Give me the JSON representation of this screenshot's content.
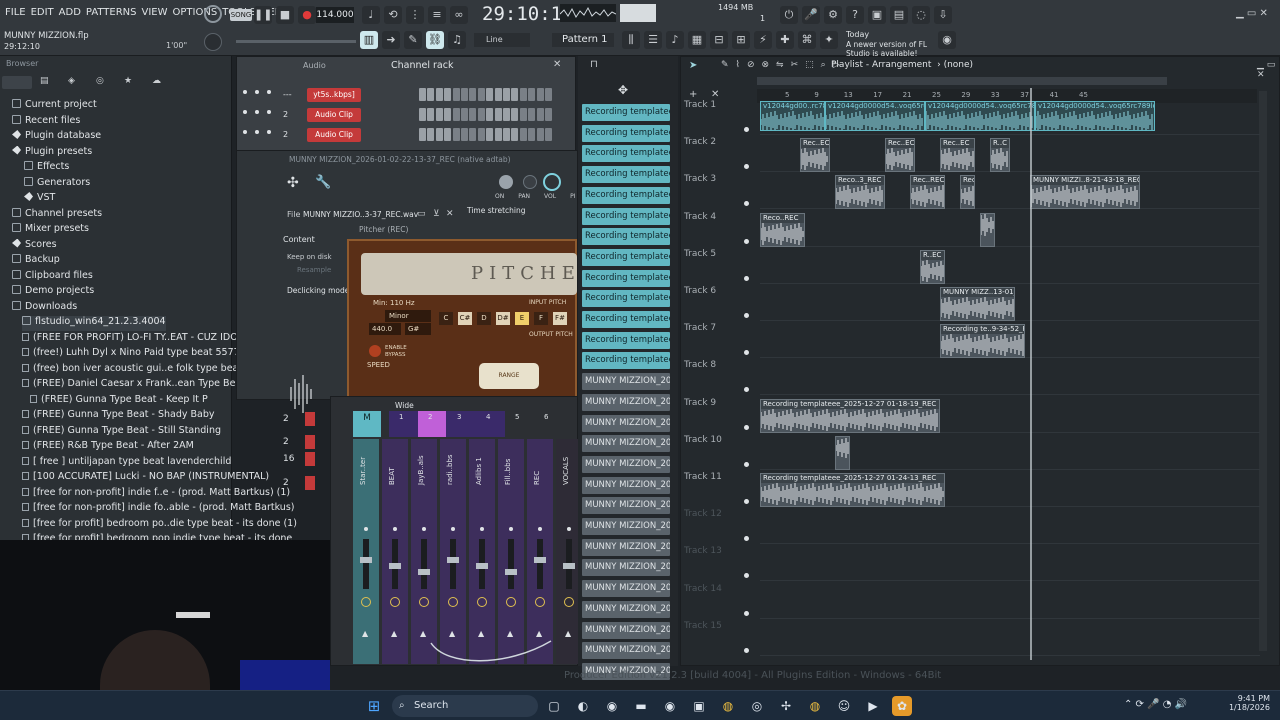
{
  "menu": [
    "FILE",
    "EDIT",
    "ADD",
    "PATTERNS",
    "VIEW",
    "OPTIONS",
    "TOOLS",
    "HELP"
  ],
  "project": {
    "name": "MUNNY MIZZION.flp",
    "time": "29:12:10",
    "tempo": "114.000",
    "song_time": "29:10:18",
    "song_time_small": "B",
    "memory": "1494 MB",
    "cpu": "1",
    "line_mode": "Line",
    "pattern": "Pattern 1",
    "song_label": "SONG",
    "hint": "1'00\""
  },
  "news": {
    "when": "Today",
    "text": "A newer version of FL Studio is available!"
  },
  "browser": {
    "title": "Browser",
    "items": [
      {
        "label": "Current project",
        "icon": "folder-icon",
        "indent": 12
      },
      {
        "label": "Recent files",
        "icon": "folder-icon",
        "indent": 12
      },
      {
        "label": "Plugin database",
        "icon": "plugin-icon",
        "indent": 12
      },
      {
        "label": "Plugin presets",
        "icon": "plugin-icon",
        "indent": 12
      },
      {
        "label": "Effects",
        "icon": "folder-icon",
        "indent": 24
      },
      {
        "label": "Generators",
        "icon": "folder-icon",
        "indent": 24
      },
      {
        "label": "VST",
        "icon": "plugin-icon",
        "indent": 24
      },
      {
        "label": "Channel presets",
        "icon": "folder-icon",
        "indent": 12
      },
      {
        "label": "Mixer presets",
        "icon": "folder-icon",
        "indent": 12
      },
      {
        "label": "Scores",
        "icon": "plugin-icon",
        "indent": 12
      },
      {
        "label": "Backup",
        "icon": "folder-icon",
        "indent": 12
      },
      {
        "label": "Clipboard files",
        "icon": "folder-icon",
        "indent": 12
      },
      {
        "label": "Demo projects",
        "icon": "folder-icon",
        "indent": 12
      },
      {
        "label": "Downloads",
        "icon": "folder-icon",
        "indent": 12
      },
      {
        "label": "flstudio_win64_21.2.3.4004",
        "icon": "folder-icon",
        "indent": 22
      },
      {
        "label": "(FREE FOR PROFIT) LO-FI TY..EAT - CUZ IDONT EVEN KNOW",
        "icon": "file-icon",
        "indent": 22
      },
      {
        "label": "(free!) Luhh Dyl x Nino Paid type beat 5577",
        "icon": "file-icon",
        "indent": 22
      },
      {
        "label": "(free) bon iver  acoustic gui..e folk type beat - laying here",
        "icon": "file-icon",
        "indent": 22
      },
      {
        "label": "(FREE) Daniel Caesar x Frank..ean Type Beat - Tied To You",
        "icon": "file-icon",
        "indent": 22
      },
      {
        "label": "(FREE) Gunna Type Beat - Keep It P",
        "icon": "file-icon",
        "indent": 30
      },
      {
        "label": "(FREE) Gunna Type Beat - Shady Baby",
        "icon": "file-icon",
        "indent": 22
      },
      {
        "label": "(FREE) Gunna Type Beat - Still Standing",
        "icon": "file-icon",
        "indent": 22
      },
      {
        "label": "(FREE) R&B Type Beat - After 2AM",
        "icon": "file-icon",
        "indent": 22
      },
      {
        "label": "[ free ] untiljapan type beat lavenderchild",
        "icon": "file-icon",
        "indent": 22
      },
      {
        "label": "[100 ACCURATE] Lucki - NO BAP (INSTRUMENTAL)",
        "icon": "file-icon",
        "indent": 22
      },
      {
        "label": "[free for non-profit] indie f..e - (prod. Matt Bartkus) (1)",
        "icon": "file-icon",
        "indent": 22
      },
      {
        "label": "[free for non-profit] indie fo..able - (prod. Matt Bartkus)",
        "icon": "file-icon",
        "indent": 22
      },
      {
        "label": "[free for profit] bedroom po..die type beat - its done (1)",
        "icon": "file-icon",
        "indent": 22
      },
      {
        "label": "[free for profit] bedroom pop  indie type beat - its done",
        "icon": "file-icon",
        "indent": 22
      }
    ]
  },
  "channel_rack": {
    "title": "Channel rack",
    "filter": "Audio",
    "channels": [
      {
        "num": "---",
        "name": "yt5s..kbps]"
      },
      {
        "num": "2",
        "name": "Audio Clip"
      },
      {
        "num": "2",
        "name": "Audio Clip"
      }
    ],
    "lower_nums": [
      "2",
      "2",
      "16",
      "2"
    ]
  },
  "sampler": {
    "title": "MUNNY MIZZION_2026-01-02-22-13-37_REC",
    "title_suffix": "(native adtab)",
    "file_label": "File",
    "file_name": "MUNNY MIZZIO..3-37_REC.wav",
    "time_stretch": "Time stretching",
    "content": "Content",
    "keep": "Keep on disk",
    "resample": "Resample",
    "declick": "Declicking mode",
    "knobs": [
      "ON",
      "PAN",
      "VOL",
      "PI"
    ],
    "plugin": "Pitcher (REC)",
    "plugin_logo": "PITCHER",
    "min_label": "Min: 110 Hz",
    "input_pitch": "INPUT PITCH",
    "output_pitch": "OUTPUT PITCH",
    "tuning": "440.0",
    "key": "G#",
    "scale": "Minor",
    "notes": [
      "C",
      "C#",
      "D",
      "D#",
      "E",
      "F",
      "F#"
    ],
    "enable": "ENABLE BYPASS",
    "speed": "SPEED",
    "range": "RANGE"
  },
  "mixer": {
    "mode": "Wide",
    "master": "M",
    "slot_nums": [
      "1",
      "2",
      "3",
      "4",
      "5",
      "6"
    ],
    "strips": [
      "Star..ter",
      "BEAT",
      "JayB..als",
      "radi..bbs",
      "Adlibs 1",
      "Fill..bbs",
      "REC",
      "VOCALS"
    ]
  },
  "picker": [
    "Recording templateee_2..",
    "Recording templateee_2..",
    "Recording templateee_2..",
    "Recording templateee_2..",
    "Recording templateee_2..",
    "Recording templateee_2..",
    "Recording templateee_2..",
    "Recording templateee_2..",
    "Recording templateee_2..",
    "Recording templateee_2..",
    "Recording templateee_2..",
    "Recording templateee_2..",
    "Recording templateee_2..",
    "MUNNY MIZZION_2026-0..",
    "MUNNY MIZZION_2026-0..",
    "MUNNY MIZZION_2026-0..",
    "MUNNY MIZZION_2026-0..",
    "MUNNY MIZZION_2026-0..",
    "MUNNY MIZZION_2026-0..",
    "MUNNY MIZZION_2026-0..",
    "MUNNY MIZZION_2026-0..",
    "MUNNY MIZZION_2026-0..",
    "MUNNY MIZZION_2026-0..",
    "MUNNY MIZZION_2026-0..",
    "MUNNY MIZZION_2026-0..",
    "MUNNY MIZZION_2026-0..",
    "MUNNY MIZZION_2026-0..",
    "MUNNY MIZZION_2026-0.."
  ],
  "playlist": {
    "title": "Playlist - Arrangement",
    "selector": "(none)",
    "ruler": [
      "5",
      "9",
      "13",
      "17",
      "21",
      "25",
      "29",
      "33",
      "37",
      "41",
      "45"
    ],
    "tracks": [
      "Track 1",
      "Track 2",
      "Track 3",
      "Track 4",
      "Track 5",
      "Track 6",
      "Track 7",
      "Track 8",
      "Track 9",
      "Track 10",
      "Track 11",
      "Track 12",
      "Track 13",
      "Track 14",
      "Track 15"
    ],
    "clips": [
      {
        "t": "v12044gd00..rc789lcs",
        "track": 0,
        "start": 0,
        "len": 0.13
      },
      {
        "t": "v12044gd0000d54..voq65rc789lcs",
        "track": 0,
        "start": 0.13,
        "len": 0.2
      },
      {
        "t": "v12044gd0000d54..voq65rc789lcs",
        "track": 0,
        "start": 0.33,
        "len": 0.22
      },
      {
        "t": "v12044gd0000d54..voq65rc789lcug",
        "track": 0,
        "start": 0.55,
        "len": 0.24
      },
      {
        "t": "Rec..EC",
        "track": 1,
        "start": 0.08,
        "len": 0.06
      },
      {
        "t": "Rec..EC",
        "track": 1,
        "start": 0.25,
        "len": 0.06
      },
      {
        "t": "Rec..EC",
        "track": 1,
        "start": 0.36,
        "len": 0.07
      },
      {
        "t": "R..C",
        "track": 1,
        "start": 0.46,
        "len": 0.04
      },
      {
        "t": "Reco..3_REC",
        "track": 2,
        "start": 0.15,
        "len": 0.1
      },
      {
        "t": "Rec..REC",
        "track": 2,
        "start": 0.3,
        "len": 0.07
      },
      {
        "t": "Rec..",
        "track": 2,
        "start": 0.4,
        "len": 0.03
      },
      {
        "t": "MUNNY MIZZI..8-21-43-18_REC",
        "track": 2,
        "start": 0.54,
        "len": 0.22
      },
      {
        "t": "Reco..REC",
        "track": 3,
        "start": 0,
        "len": 0.09
      },
      {
        "t": "",
        "track": 3,
        "start": 0.44,
        "len": 0.03
      },
      {
        "t": "R..EC",
        "track": 4,
        "start": 0.32,
        "len": 0.05
      },
      {
        "t": "MUNNY MIZZ..13-01_REC",
        "track": 5,
        "start": 0.36,
        "len": 0.15
      },
      {
        "t": "Recording te..9-34-52_REC",
        "track": 6,
        "start": 0.36,
        "len": 0.17
      },
      {
        "t": "Recording templateee_2025-12-27 01-18-19_REC",
        "track": 8,
        "start": 0,
        "len": 0.36
      },
      {
        "t": "",
        "track": 9,
        "start": 0.15,
        "len": 0.03
      },
      {
        "t": "Recording templateee_2025-12-27 01-24-13_REC",
        "track": 10,
        "start": 0,
        "len": 0.37
      }
    ]
  },
  "status": "Producer Edition v21.2.3 [build 4004] - All Plugins Edition - Windows - 64Bit",
  "taskbar": {
    "search": "Search",
    "time": "9:41 PM",
    "date": "1/18/2026",
    "apps": [
      "files-icon",
      "copilot-icon",
      "edge-icon",
      "folder-icon",
      "edge-icon",
      "store-icon",
      "chrome-icon",
      "steam-icon",
      "app-icon",
      "chrome-icon",
      "discord-icon",
      "media-icon",
      "fl-icon"
    ]
  },
  "colors": {
    "accent": "#7fd1de",
    "clip_teal": "#62b7c2",
    "record": "#e03a3a",
    "mixer_purple": "#5a3c7a"
  }
}
